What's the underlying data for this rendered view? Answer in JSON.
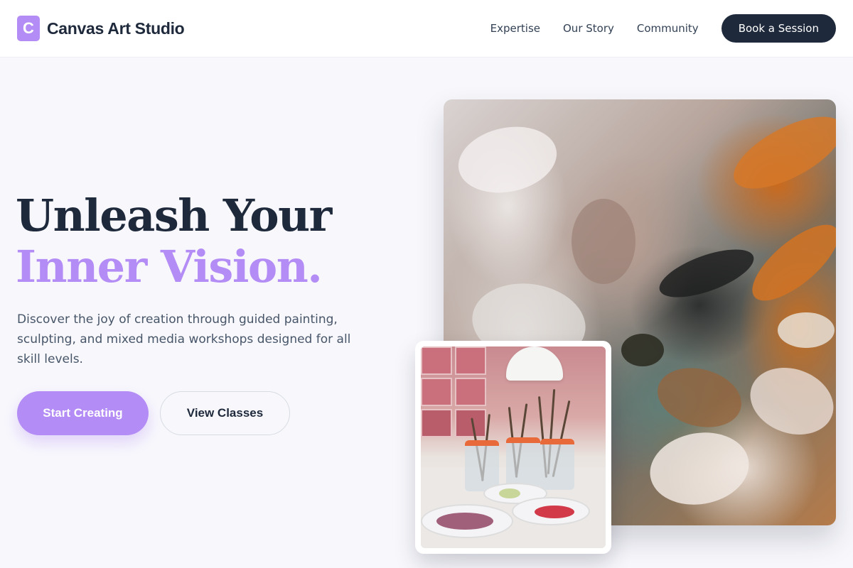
{
  "header": {
    "logo_letter": "C",
    "brand": "Canvas Art Studio",
    "nav": [
      {
        "label": "Expertise"
      },
      {
        "label": "Our Story"
      },
      {
        "label": "Community"
      }
    ],
    "cta": "Book a Session"
  },
  "hero": {
    "title_line1": "Unleash Your",
    "title_line2": "Inner Vision.",
    "description": "Discover the joy of creation through guided painting, sculpting, and mixed media workshops designed for all skill levels.",
    "primary_button": "Start Creating",
    "secondary_button": "View Classes"
  },
  "colors": {
    "accent": "#b48cf5",
    "dark": "#1e293b",
    "text_muted": "#475569",
    "background": "#f8f8fc"
  },
  "images": {
    "main": "textured-oil-painting",
    "secondary": "paint-brushes-in-jars"
  }
}
